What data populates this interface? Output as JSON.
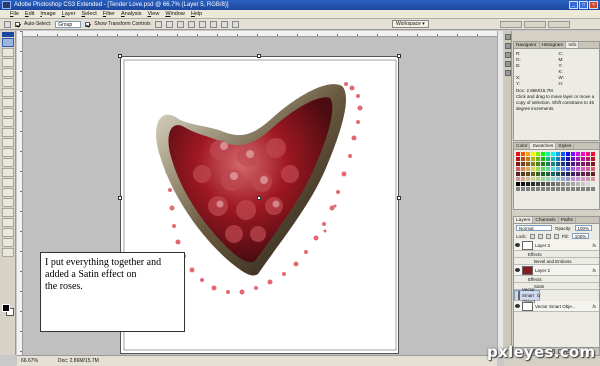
{
  "window": {
    "title": "Adobe Photoshop CS3 Extended - [Tender Love.psd @ 66.7% (Layer 5, RGB/8)]"
  },
  "menu": [
    "File",
    "Edit",
    "Image",
    "Layer",
    "Select",
    "Filter",
    "Analysis",
    "View",
    "Window",
    "Help"
  ],
  "options": {
    "auto_select_label": "Auto-Select:",
    "auto_select_value": "Group",
    "show_transform_label": "Show Transform Controls",
    "workspace_label": "Workspace ▾"
  },
  "canvas": {
    "note_lines": [
      "I put everything together and",
      "added a Satin effect on",
      "the roses."
    ]
  },
  "status": {
    "zoom": "66.67%",
    "doc": "Doc: 2.86M/15.7M"
  },
  "panels": {
    "nav_tabs": [
      "Navigator",
      "Histogram",
      "Info"
    ],
    "info": {
      "r": "R:",
      "g": "G:",
      "b": "B:",
      "c": "C:",
      "m": "M:",
      "y": "Y:",
      "k": "K:",
      "x": "X:",
      "yy": "Y:",
      "w": "W:",
      "h": "H:",
      "doc": "Doc: 2.86M/15.7M",
      "hint": "Click and drag to move layer or move a copy of selection. Shift constrains to 45 degree increments."
    },
    "color_tabs": [
      "Color",
      "Swatches",
      "Styles"
    ],
    "layers_tabs": [
      "Layers",
      "Channels",
      "Paths"
    ],
    "blend_mode": "Normal",
    "opacity_label": "Opacity:",
    "opacity_value": "100%",
    "lock_label": "Lock:",
    "fill_label": "Fill:",
    "fill_value": "100%",
    "layers": [
      {
        "name": "Layer 3",
        "kind": "layer"
      },
      {
        "name": "Effects",
        "kind": "sub"
      },
      {
        "name": "Bevel and Emboss",
        "kind": "sub2"
      },
      {
        "name": "Layer 2",
        "kind": "layer"
      },
      {
        "name": "Effects",
        "kind": "sub"
      },
      {
        "name": "Satin",
        "kind": "sub2"
      },
      {
        "name": "Vector Smart Object",
        "kind": "layer"
      },
      {
        "name": "Vector Smart Obje...",
        "kind": "layer"
      }
    ],
    "fx_mark": "fx"
  },
  "watermark": "pxleyes.com",
  "colors": {
    "title_bar": "#1c48a0",
    "heart_red": "#a01822",
    "heart_dark": "#3a2a1e",
    "confetti": "#e0505a"
  }
}
